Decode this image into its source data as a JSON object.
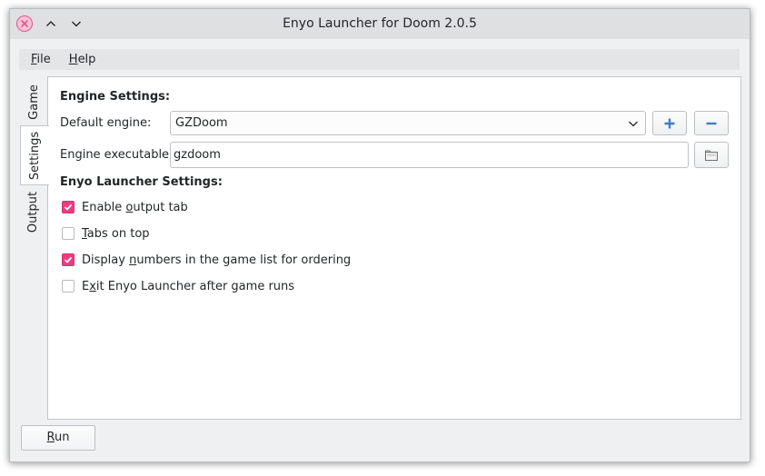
{
  "window": {
    "title": "Enyo Launcher for Doom 2.0.5"
  },
  "menu": [
    {
      "mnemonic": "F",
      "rest": "ile"
    },
    {
      "mnemonic": "H",
      "rest": "elp"
    }
  ],
  "side_tabs": {
    "game": "Game",
    "settings": "Settings",
    "output": "Output",
    "active": "settings"
  },
  "engine_settings": {
    "heading": "Engine Settings:",
    "default_engine_label": "Default engine:",
    "default_engine_value": "GZDoom",
    "executable_label": "Engine executable:",
    "executable_value": "gzdoom"
  },
  "launcher_settings": {
    "heading": "Enyo Launcher Settings:",
    "options": [
      {
        "before": "Enable ",
        "mnemonic": "o",
        "after": "utput tab",
        "checked": true
      },
      {
        "before": "",
        "mnemonic": "T",
        "after": "abs on top",
        "checked": false
      },
      {
        "before": "Display ",
        "mnemonic": "n",
        "after": "umbers in the game list for ordering",
        "checked": true
      },
      {
        "before": "E",
        "mnemonic": "x",
        "after": "it Enyo Launcher after game runs",
        "checked": false
      }
    ]
  },
  "run_button": {
    "mnemonic": "R",
    "rest": "un"
  },
  "icons": {
    "close": "close-icon",
    "minimize": "chevron-up-icon",
    "maximize": "chevron-down-icon",
    "add": "plus-icon",
    "remove": "minus-icon",
    "browse": "folder-icon",
    "combo": "chevron-down-icon",
    "check": "check-icon"
  },
  "colors": {
    "accent": "#e93d82",
    "add_icon": "#3d7dca"
  }
}
